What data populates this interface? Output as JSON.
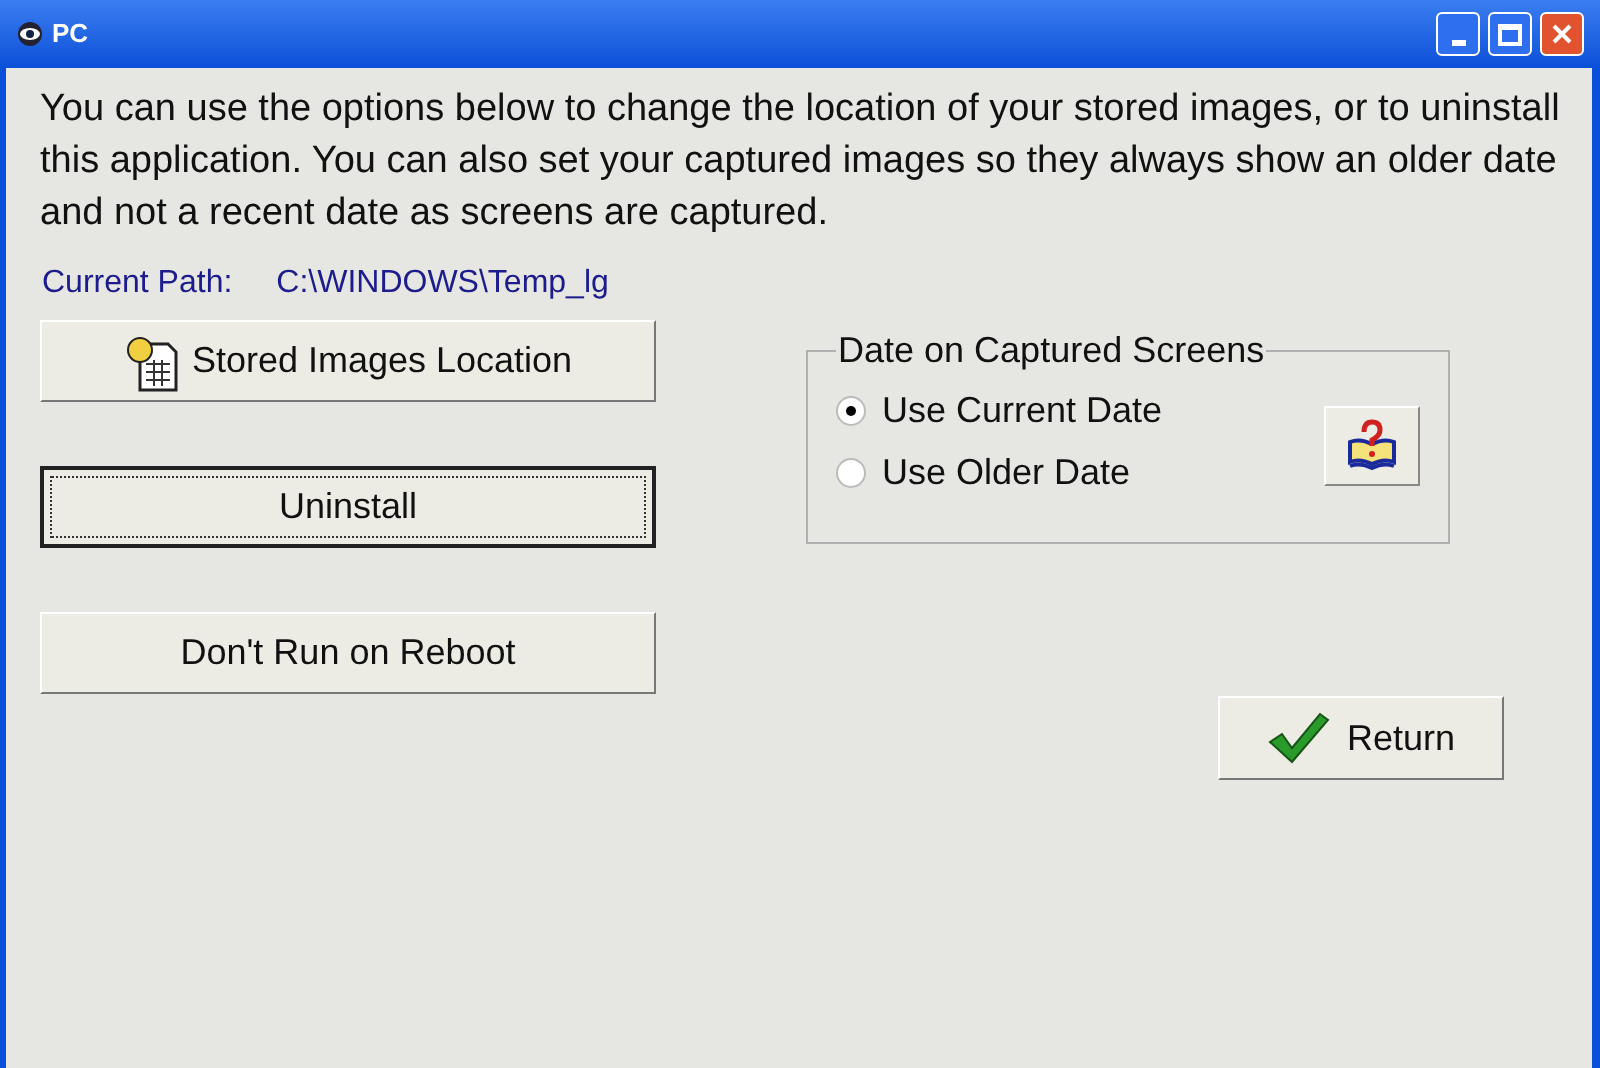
{
  "window": {
    "title": "PC"
  },
  "intro": "You can use the options below to change the location of your stored images, or to uninstall this application.  You can also set your captured images so they always show an older date and not a recent date as screens are captured.",
  "path": {
    "label": "Current Path:",
    "value": "C:\\WINDOWS\\Temp_lg"
  },
  "buttons": [
    {
      "label": "Stored Images Location",
      "kind": "folder",
      "focused": false
    },
    {
      "label": "Uninstall",
      "kind": "plain",
      "focused": true
    },
    {
      "label": "Don't Run on Reboot",
      "kind": "plain",
      "focused": false
    }
  ],
  "date_group": {
    "title": "Date on Captured Screens",
    "options": [
      {
        "label": "Use Current Date",
        "selected": true
      },
      {
        "label": "Use Older Date",
        "selected": false
      }
    ]
  },
  "return_button": {
    "label": "Return"
  }
}
